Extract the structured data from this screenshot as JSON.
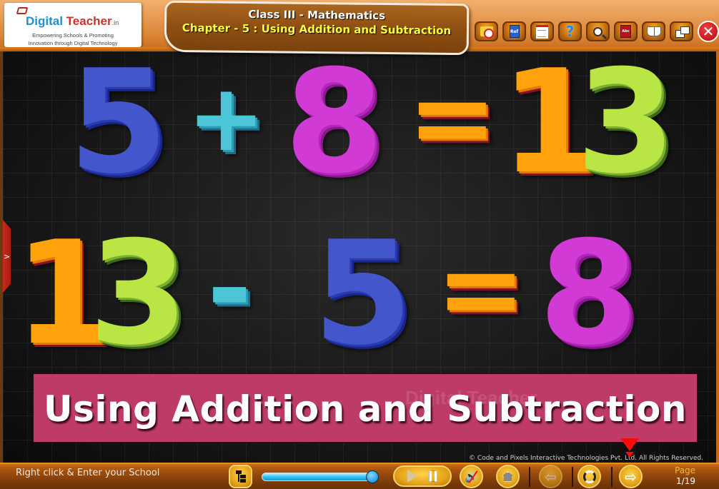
{
  "brand": {
    "name_part1": "Digital",
    "name_part2": " Teacher",
    "suffix": ".in",
    "tagline_line1": "Empowering Schools & Promoting",
    "tagline_line2": "Innovation through Digital Technology"
  },
  "header": {
    "course_title": "Class III - Mathematics",
    "chapter_title": "Chapter - 5 : Using Addition and Subtraction"
  },
  "toolbar": {
    "buttons": [
      {
        "name": "timer",
        "icon": "clock-folder-icon"
      },
      {
        "name": "reference",
        "icon": "reference-book-icon",
        "label": "Ref"
      },
      {
        "name": "notes",
        "icon": "notepad-icon"
      },
      {
        "name": "help",
        "icon": "help-icon",
        "label": "?"
      },
      {
        "name": "search",
        "icon": "magnifier-icon"
      },
      {
        "name": "dictionary",
        "icon": "dictionary-icon",
        "label": "Abc"
      },
      {
        "name": "open-book",
        "icon": "open-book-icon"
      },
      {
        "name": "window-mode",
        "icon": "restore-window-icon"
      },
      {
        "name": "close",
        "icon": "close-icon",
        "label": "✕"
      }
    ]
  },
  "slide": {
    "equations": [
      {
        "operand1": "5",
        "operator": "+",
        "operand2": "8",
        "equals": "=",
        "result_digit1": "1",
        "result_digit2": "3"
      },
      {
        "operand1_digit1": "1",
        "operand1_digit2": "3",
        "operator": "-",
        "operand2": "5",
        "equals": "=",
        "result": "8"
      }
    ],
    "banner_title": "Using Addition and Subtraction",
    "watermark": "Digital Teacher",
    "side_tab_glyph": ">",
    "copyright": "© Code and Pixels Interactive Technologies  Pvt. Ltd. All Rights Reserved."
  },
  "footer": {
    "school_prompt": "Right click & Enter your School",
    "progress_percent": 100,
    "play_state": "paused",
    "sound": "muted",
    "page_label": "Page",
    "page_current": 1,
    "page_total": 19,
    "page_display": "1/19"
  },
  "colors": {
    "banner": "#bd3b66",
    "page_label": "#f2b640",
    "chapter_title": "#ffff3c"
  }
}
